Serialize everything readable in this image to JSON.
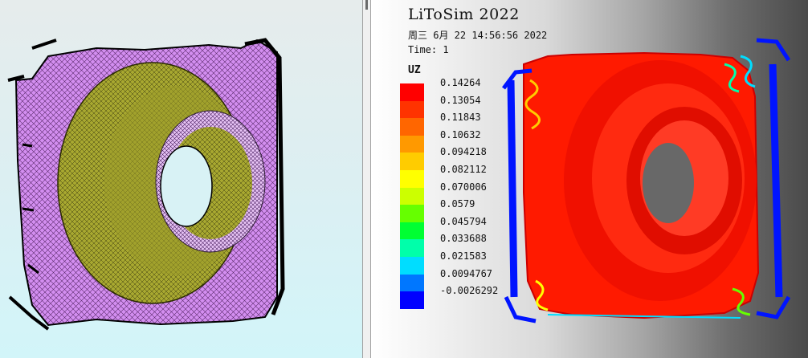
{
  "viewer": {
    "app_title": "LiToSim 2022",
    "timestamp": "周三 6月 22 14:56:56 2022",
    "time_label": "Time: 1",
    "variable": "UZ",
    "legend": [
      {
        "value": "0.14264",
        "color": "#ff0000"
      },
      {
        "value": "0.13054",
        "color": "#ff3300"
      },
      {
        "value": "0.11843",
        "color": "#ff6600"
      },
      {
        "value": "0.10632",
        "color": "#ff9900"
      },
      {
        "value": "0.094218",
        "color": "#ffcc00"
      },
      {
        "value": "0.082112",
        "color": "#ffff00"
      },
      {
        "value": "0.070006",
        "color": "#ccff00"
      },
      {
        "value": "0.0579",
        "color": "#66ff00"
      },
      {
        "value": "0.045794",
        "color": "#00ff33"
      },
      {
        "value": "0.033688",
        "color": "#00ffaa"
      },
      {
        "value": "0.021583",
        "color": "#00ddff"
      },
      {
        "value": "0.0094767",
        "color": "#0077ff"
      },
      {
        "value": "-0.0026292",
        "color": "#0000ff"
      }
    ]
  },
  "colors": {
    "mesh_fill": "#d38ef0",
    "mesh_surface": "#a8a830",
    "contour_max": "#ff0000",
    "contour_min": "#0000ff"
  }
}
